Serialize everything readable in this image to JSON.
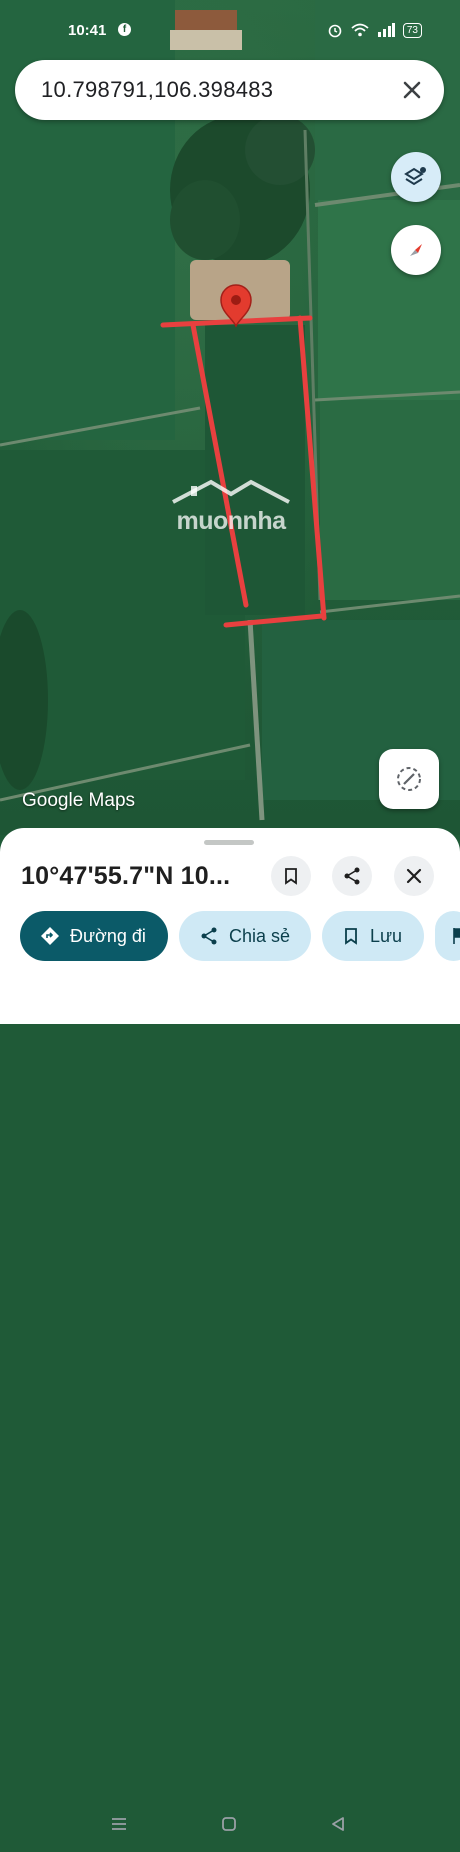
{
  "status_bar": {
    "time": "10:41",
    "battery": "73"
  },
  "search": {
    "query": "10.798791,106.398483"
  },
  "watermark": {
    "brand": "muonnha"
  },
  "map": {
    "attribution": "Google Maps"
  },
  "place": {
    "title": "10°47'55.7\"N 10...",
    "actions": [
      {
        "label": "Đường đi"
      },
      {
        "label": "Chia sẻ"
      },
      {
        "label": "Lưu"
      }
    ]
  },
  "colors": {
    "plot_outline": "#e8403f",
    "pin": "#e33b2e",
    "primary_chip": "#0b5a68",
    "secondary_chip": "#cfe9f5"
  }
}
